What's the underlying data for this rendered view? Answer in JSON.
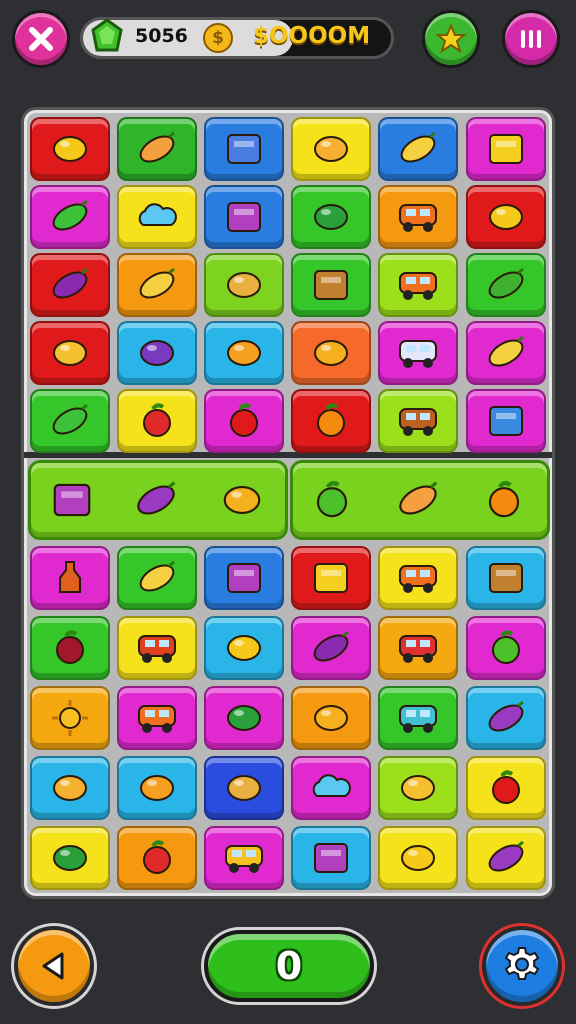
{
  "hud": {
    "close_icon": "close-x-icon",
    "lives": "5056",
    "coin_symbol": "$",
    "coins": "$OOOOM",
    "bonus_icon": "star-bag-icon",
    "pause_icon": "pause-icon"
  },
  "board": {
    "rows_top": [
      [
        {
          "color": "#e01a1a",
          "item": "lemon"
        },
        {
          "color": "#2fb52a",
          "item": "carrot"
        },
        {
          "color": "#2a7de0",
          "item": "calendar"
        },
        {
          "color": "#f5e21a",
          "item": "cheese"
        },
        {
          "color": "#2a7de0",
          "item": "corn"
        },
        {
          "color": "#e02ad0",
          "item": "cheese-block"
        }
      ],
      [
        {
          "color": "#e02ad0",
          "item": "leaf"
        },
        {
          "color": "#f5e21a",
          "item": "cloud"
        },
        {
          "color": "#2a7de0",
          "item": "crate"
        },
        {
          "color": "#35c62a",
          "item": "pepper"
        },
        {
          "color": "#f59a10",
          "item": "van"
        },
        {
          "color": "#e01a1a",
          "item": "lemon"
        }
      ],
      [
        {
          "color": "#e01a1a",
          "item": "plum"
        },
        {
          "color": "#f59a10",
          "item": "banana"
        },
        {
          "color": "#7ed321",
          "item": "cracker"
        },
        {
          "color": "#35c62a",
          "item": "box"
        },
        {
          "color": "#9be01a",
          "item": "van"
        },
        {
          "color": "#35c62a",
          "item": "cucumber"
        }
      ],
      [
        {
          "color": "#e01a1a",
          "item": "cone"
        },
        {
          "color": "#2ab5e8",
          "item": "grape"
        },
        {
          "color": "#2ab5e8",
          "item": "mushroom"
        },
        {
          "color": "#f56a2a",
          "item": "mango"
        },
        {
          "color": "#e02ad0",
          "item": "cloud-car"
        },
        {
          "color": "#e02ad0",
          "item": "banana"
        }
      ],
      [
        {
          "color": "#35c62a",
          "item": "leaf"
        },
        {
          "color": "#f5e21a",
          "item": "strawberry"
        },
        {
          "color": "#e02ad0",
          "item": "tomato"
        },
        {
          "color": "#e01a1a",
          "item": "orange"
        },
        {
          "color": "#9be01a",
          "item": "cart"
        },
        {
          "color": "#e02ad0",
          "item": "cube"
        }
      ]
    ],
    "wide_row": [
      {
        "item": "crate"
      },
      {
        "item": "eggplant"
      },
      {
        "item": "mango"
      },
      {
        "item": "apple"
      },
      {
        "item": "carrot"
      },
      {
        "item": "orange"
      }
    ],
    "rows_bottom": [
      [
        {
          "color": "#e02ad0",
          "item": "bottle"
        },
        {
          "color": "#35c62a",
          "item": "banana"
        },
        {
          "color": "#2a7de0",
          "item": "crate"
        },
        {
          "color": "#e01a1a",
          "item": "safe"
        },
        {
          "color": "#f5e21a",
          "item": "van"
        },
        {
          "color": "#2ab5e8",
          "item": "box"
        }
      ],
      [
        {
          "color": "#35c62a",
          "item": "beet"
        },
        {
          "color": "#f5e21a",
          "item": "truck"
        },
        {
          "color": "#2ab5e8",
          "item": "lemon"
        },
        {
          "color": "#e02ad0",
          "item": "plum"
        },
        {
          "color": "#f5a810",
          "item": "scooter"
        },
        {
          "color": "#e02ad0",
          "item": "apple"
        }
      ],
      [
        {
          "color": "#f5a810",
          "item": "sun"
        },
        {
          "color": "#e02ad0",
          "item": "van"
        },
        {
          "color": "#e02ad0",
          "item": "pepper"
        },
        {
          "color": "#f59a10",
          "item": "mango"
        },
        {
          "color": "#35c62a",
          "item": "car"
        },
        {
          "color": "#2ab5e8",
          "item": "eggplant"
        }
      ],
      [
        {
          "color": "#2ab5e8",
          "item": "cheese"
        },
        {
          "color": "#2ab5e8",
          "item": "mushroom"
        },
        {
          "color": "#2a4de0",
          "item": "cracker"
        },
        {
          "color": "#e02ad0",
          "item": "cloud"
        },
        {
          "color": "#9be01a",
          "item": "pear"
        },
        {
          "color": "#f5e21a",
          "item": "tomato"
        }
      ],
      [
        {
          "color": "#f5e21a",
          "item": "pepper"
        },
        {
          "color": "#f59a10",
          "item": "strawberry"
        },
        {
          "color": "#e02ad0",
          "item": "lemon-car"
        },
        {
          "color": "#2ab5e8",
          "item": "crate"
        },
        {
          "color": "#f5e21a",
          "item": "lemon"
        },
        {
          "color": "#f5e21a",
          "item": "eggplant"
        }
      ]
    ]
  },
  "controls": {
    "back_icon": "triangle-left-icon",
    "play_label": "0",
    "settings_icon": "gear-icon"
  }
}
